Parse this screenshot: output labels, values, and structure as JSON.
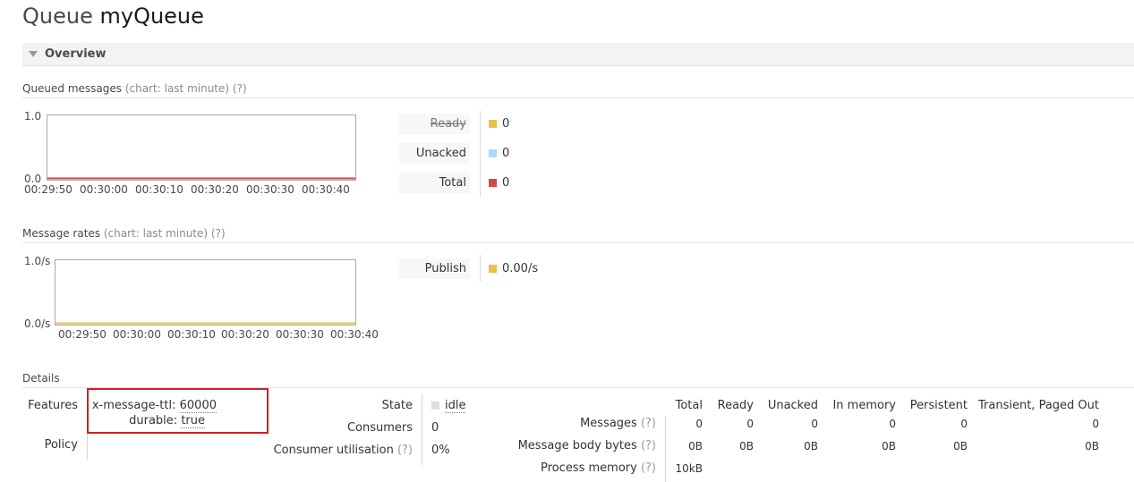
{
  "header": {
    "title_prefix": "Queue",
    "queue_name": "myQueue"
  },
  "overview": {
    "label": "Overview"
  },
  "queued_messages": {
    "title": "Queued messages",
    "subtitle": "(chart: last minute)",
    "help": "(?)",
    "y_top": "1.0",
    "y_bottom": "0.0",
    "x_ticks": [
      "00:29:50",
      "00:30:00",
      "00:30:10",
      "00:30:20",
      "00:30:30",
      "00:30:40"
    ],
    "legend": [
      {
        "label": "Ready",
        "value": "0",
        "color": "#edc240",
        "strike": true
      },
      {
        "label": "Unacked",
        "value": "0",
        "color": "#afd8f8",
        "strike": false
      },
      {
        "label": "Total",
        "value": "0",
        "color": "#cb4b4b",
        "strike": false
      }
    ]
  },
  "message_rates": {
    "title": "Message rates",
    "subtitle": "(chart: last minute)",
    "help": "(?)",
    "y_top": "1.0/s",
    "y_bottom": "0.0/s",
    "x_ticks": [
      "00:29:50",
      "00:30:00",
      "00:30:10",
      "00:30:20",
      "00:30:30",
      "00:30:40"
    ],
    "legend": [
      {
        "label": "Publish",
        "value": "0.00/s",
        "color": "#edc240",
        "strike": false
      }
    ]
  },
  "details": {
    "title": "Details",
    "features_label": "Features",
    "features": [
      {
        "key": "x-message-ttl:",
        "value": "60000"
      },
      {
        "key": "durable:",
        "value": "true"
      }
    ],
    "policy_label": "Policy",
    "state_label": "State",
    "state_value": "idle",
    "state_color": "#dddddd",
    "consumers_label": "Consumers",
    "consumers_value": "0",
    "consumer_util_label": "Consumer utilisation",
    "consumer_util_help": "(?)",
    "consumer_util_value": "0%"
  },
  "stats": {
    "columns": [
      "Total",
      "Ready",
      "Unacked",
      "In memory",
      "Persistent",
      "Transient, Paged Out"
    ],
    "rows": [
      {
        "label": "Messages",
        "help": "(?)",
        "values": [
          "0",
          "0",
          "0",
          "0",
          "0",
          "0"
        ]
      },
      {
        "label": "Message body bytes",
        "help": "(?)",
        "values": [
          "0B",
          "0B",
          "0B",
          "0B",
          "0B",
          "0B"
        ]
      },
      {
        "label": "Process memory",
        "help": "(?)",
        "values": [
          "10kB"
        ]
      }
    ]
  }
}
